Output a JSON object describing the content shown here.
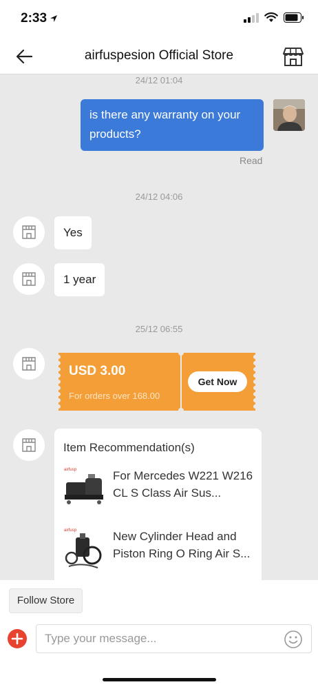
{
  "status_bar": {
    "time": "2:33"
  },
  "header": {
    "title": "airfuspesion Official Store"
  },
  "chat": {
    "timestamps": [
      "24/12 01:04",
      "24/12 04:06",
      "25/12 06:55"
    ],
    "outgoing_message": "is there any warranty on your products?",
    "read_status": "Read",
    "incoming_messages": [
      "Yes",
      "1 year"
    ],
    "coupon": {
      "amount": "USD 3.00",
      "condition": "For orders over 168.00",
      "button_label": "Get Now",
      "color": "#f39e36"
    },
    "recommendation": {
      "title": "Item Recommendation(s)",
      "items": [
        {
          "name": "For Mercedes W221 W216 CL S Class Air Sus...",
          "icon": "air-compressor-product-image"
        },
        {
          "name": "New Cylinder Head and Piston Ring O Ring Air S...",
          "icon": "cylinder-head-product-image"
        }
      ]
    }
  },
  "bottom_bar": {
    "follow_label": "Follow Store",
    "input_placeholder": "Type your message..."
  },
  "colors": {
    "accent_blue": "#3b7ad9",
    "add_button_red": "#e8432e",
    "chat_background": "#e9e9e9"
  }
}
